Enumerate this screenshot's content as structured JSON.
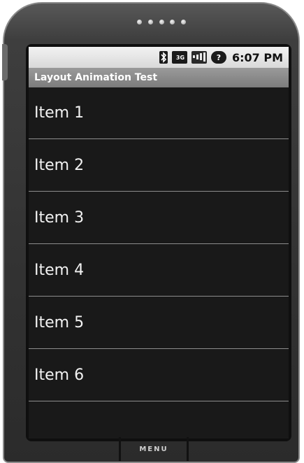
{
  "status_bar": {
    "icons": [
      "bluetooth-icon",
      "network-3g-icon",
      "signal-icon",
      "battery-icon"
    ],
    "network_label": "3G",
    "battery_label": "?",
    "time": "6:07 PM"
  },
  "app": {
    "title": "Layout Animation Test"
  },
  "list": {
    "items": [
      {
        "label": "Item 1"
      },
      {
        "label": "Item 2"
      },
      {
        "label": "Item 3"
      },
      {
        "label": "Item 4"
      },
      {
        "label": "Item 5"
      },
      {
        "label": "Item 6"
      }
    ]
  },
  "hardware": {
    "menu_label": "MENU"
  },
  "colors": {
    "list_background": "#191919",
    "title_bar": "#8a8a8a",
    "divider": "#8d8d8d"
  }
}
